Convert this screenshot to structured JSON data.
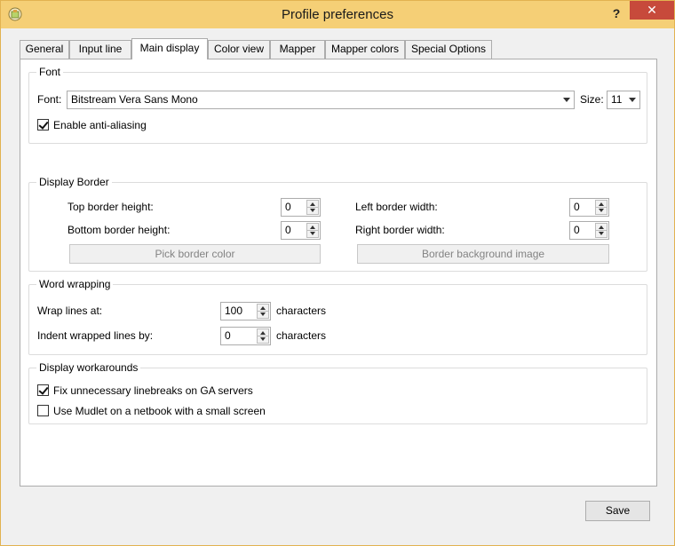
{
  "window": {
    "title": "Profile preferences",
    "help_label": "?",
    "close_label": "✕",
    "colors": {
      "titlebar": "#f5cf76",
      "close": "#c74a3b"
    }
  },
  "tabs": [
    {
      "label": "General",
      "active": false
    },
    {
      "label": "Input line",
      "active": false
    },
    {
      "label": "Main display",
      "active": true
    },
    {
      "label": "Color view",
      "active": false
    },
    {
      "label": "Mapper",
      "active": false
    },
    {
      "label": "Mapper colors",
      "active": false
    },
    {
      "label": "Special Options",
      "active": false
    }
  ],
  "font_group": {
    "title": "Font",
    "font_label": "Font:",
    "font_value": "Bitstream Vera Sans Mono",
    "size_label": "Size:",
    "size_value": "11",
    "antialias_label": "Enable anti-aliasing",
    "antialias_checked": true
  },
  "border_group": {
    "title": "Display Border",
    "top_label": "Top border height:",
    "top_value": "0",
    "bottom_label": "Bottom border height:",
    "bottom_value": "0",
    "left_label": "Left border width:",
    "left_value": "0",
    "right_label": "Right border width:",
    "right_value": "0",
    "pick_color_label": "Pick border color",
    "bg_image_label": "Border background image"
  },
  "wrap_group": {
    "title": "Word wrapping",
    "wrap_label": "Wrap lines at:",
    "wrap_value": "100",
    "wrap_unit": "characters",
    "indent_label": "Indent wrapped lines by:",
    "indent_value": "0",
    "indent_unit": "characters"
  },
  "workarounds_group": {
    "title": "Display workarounds",
    "fix_label": "Fix unnecessary linebreaks on GA servers",
    "fix_checked": true,
    "netbook_label": "Use Mudlet on a netbook with a small screen",
    "netbook_checked": false
  },
  "footer": {
    "save_label": "Save"
  }
}
